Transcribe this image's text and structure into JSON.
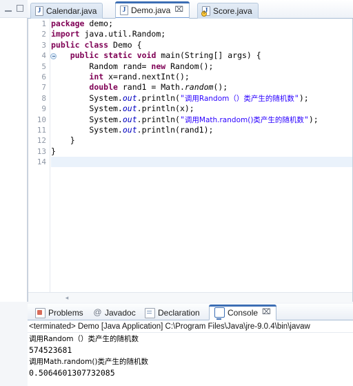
{
  "window": {
    "left_toolbar": {
      "minimize_tooltip": "Minimize",
      "maximize_tooltip": "Maximize"
    }
  },
  "editor": {
    "tabs": [
      {
        "label": "Calendar.java",
        "icon": "java-file-icon",
        "active": false,
        "has_warning": false,
        "closable": false
      },
      {
        "label": "Demo.java",
        "icon": "java-file-icon",
        "active": true,
        "has_warning": false,
        "closable": true,
        "close_glyph": "⌧"
      },
      {
        "label": "Score.java",
        "icon": "java-file-icon-warning",
        "active": false,
        "has_warning": true,
        "closable": false
      }
    ],
    "line_numbers": [
      "1",
      "2",
      "3",
      "4",
      "5",
      "6",
      "7",
      "8",
      "9",
      "10",
      "11",
      "12",
      "13",
      "14"
    ],
    "fold_marker_line": 4,
    "current_line": 14,
    "scroll_left_arrow": "◂",
    "lines": [
      {
        "n": 1,
        "segments": [
          {
            "t": "kw",
            "v": "package"
          },
          {
            "t": "txt",
            "v": " demo;"
          }
        ]
      },
      {
        "n": 2,
        "segments": [
          {
            "t": "kw",
            "v": "import"
          },
          {
            "t": "txt",
            "v": " java.util.Random;"
          }
        ]
      },
      {
        "n": 3,
        "segments": [
          {
            "t": "kw",
            "v": "public"
          },
          {
            "t": "txt",
            "v": " "
          },
          {
            "t": "kw",
            "v": "class"
          },
          {
            "t": "txt",
            "v": " Demo {"
          }
        ]
      },
      {
        "n": 4,
        "segments": [
          {
            "t": "txt",
            "v": "    "
          },
          {
            "t": "kw",
            "v": "public"
          },
          {
            "t": "txt",
            "v": " "
          },
          {
            "t": "kw",
            "v": "static"
          },
          {
            "t": "txt",
            "v": " "
          },
          {
            "t": "kw",
            "v": "void"
          },
          {
            "t": "txt",
            "v": " main(String[] args) {"
          }
        ]
      },
      {
        "n": 5,
        "segments": [
          {
            "t": "txt",
            "v": "        Random rand= "
          },
          {
            "t": "kw",
            "v": "new"
          },
          {
            "t": "txt",
            "v": " Random();"
          }
        ]
      },
      {
        "n": 6,
        "segments": [
          {
            "t": "txt",
            "v": "        "
          },
          {
            "t": "kw",
            "v": "int"
          },
          {
            "t": "txt",
            "v": " x=rand.nextInt();"
          }
        ]
      },
      {
        "n": 7,
        "segments": [
          {
            "t": "txt",
            "v": "        "
          },
          {
            "t": "kw",
            "v": "double"
          },
          {
            "t": "txt",
            "v": " rand1 = Math."
          },
          {
            "t": "mth",
            "v": "random"
          },
          {
            "t": "txt",
            "v": "();"
          }
        ]
      },
      {
        "n": 8,
        "segments": [
          {
            "t": "txt",
            "v": "        System."
          },
          {
            "t": "fld",
            "v": "out"
          },
          {
            "t": "txt",
            "v": ".println("
          },
          {
            "t": "str",
            "v": "\""
          },
          {
            "t": "cjk",
            "v": "调用Random（）类产生的随机数"
          },
          {
            "t": "str",
            "v": "\""
          },
          {
            "t": "txt",
            "v": ");"
          }
        ]
      },
      {
        "n": 9,
        "segments": [
          {
            "t": "txt",
            "v": "        System."
          },
          {
            "t": "fld",
            "v": "out"
          },
          {
            "t": "txt",
            "v": ".println(x);"
          }
        ]
      },
      {
        "n": 10,
        "segments": [
          {
            "t": "txt",
            "v": "        System."
          },
          {
            "t": "fld",
            "v": "out"
          },
          {
            "t": "txt",
            "v": ".println("
          },
          {
            "t": "str",
            "v": "\""
          },
          {
            "t": "cjk",
            "v": "调用Math.random()类产生的随机数"
          },
          {
            "t": "str",
            "v": "\""
          },
          {
            "t": "txt",
            "v": ");"
          }
        ]
      },
      {
        "n": 11,
        "segments": [
          {
            "t": "txt",
            "v": "        System."
          },
          {
            "t": "fld",
            "v": "out"
          },
          {
            "t": "txt",
            "v": ".println(rand1);"
          }
        ]
      },
      {
        "n": 12,
        "segments": [
          {
            "t": "txt",
            "v": "    }"
          }
        ]
      },
      {
        "n": 13,
        "segments": [
          {
            "t": "txt",
            "v": "}"
          }
        ]
      },
      {
        "n": 14,
        "segments": [
          {
            "t": "txt",
            "v": ""
          }
        ]
      }
    ]
  },
  "bottom_panel": {
    "tabs": [
      {
        "label": "Problems",
        "icon": "problems-icon",
        "active": false,
        "closable": false
      },
      {
        "label": "Javadoc",
        "icon": "javadoc-icon",
        "active": false,
        "closable": false
      },
      {
        "label": "Declaration",
        "icon": "declaration-icon",
        "active": false,
        "closable": false
      },
      {
        "label": "Console",
        "icon": "console-icon",
        "active": true,
        "closable": true,
        "close_glyph": "⌧"
      }
    ],
    "console": {
      "header": "<terminated> Demo [Java Application] C:\\Program Files\\Java\\jre-9.0.4\\bin\\javaw",
      "output": [
        "调用Random（）类产生的随机数",
        "574523681",
        "调用Math.random()类产生的随机数",
        "0.5064601307732085"
      ]
    }
  },
  "colors": {
    "keyword": "#7f0055",
    "string": "#2a00ff",
    "field": "#0000c0",
    "accent": "#3c6eb4",
    "current_line_bg": "#eaf2fb"
  }
}
